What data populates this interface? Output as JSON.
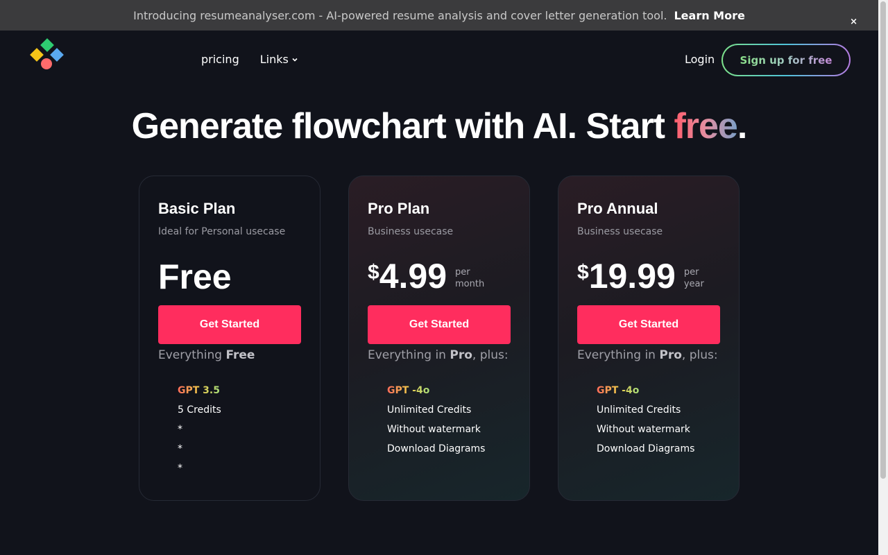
{
  "banner": {
    "text": "Introducing resumeanalyser.com - AI-powered resume analysis and cover letter generation tool.",
    "link_label": "Learn More",
    "close_label": "×"
  },
  "nav": {
    "pricing_label": "pricing",
    "links_label": "Links",
    "login_label": "Login",
    "signup_label": "Sign up for free"
  },
  "hero": {
    "title_main": "Generate flowchart with AI. Start ",
    "title_highlight": "free",
    "title_end": "."
  },
  "plans": [
    {
      "name": "Basic Plan",
      "description": "Ideal for Personal usecase",
      "price": "Free",
      "button_label": "Get Started",
      "everything_prefix": "Everything ",
      "everything_bold": "Free",
      "everything_suffix": "",
      "features": [
        "GPT 3.5",
        "5 Credits",
        "*",
        "*",
        "*"
      ]
    },
    {
      "name": "Pro Plan",
      "description": "Business usecase",
      "currency": "$",
      "amount": "4.99",
      "period_line1": "per",
      "period_line2": "month",
      "button_label": "Get Started",
      "everything_prefix": "Everything in ",
      "everything_bold": "Pro",
      "everything_suffix": ", plus:",
      "features": [
        "GPT -4o",
        "Unlimited Credits",
        "Without watermark",
        "Download Diagrams"
      ]
    },
    {
      "name": "Pro Annual",
      "description": "Business usecase",
      "currency": "$",
      "amount": "19.99",
      "period_line1": "per",
      "period_line2": "year",
      "button_label": "Get Started",
      "everything_prefix": "Everything in ",
      "everything_bold": "Pro",
      "everything_suffix": ", plus:",
      "features": [
        "GPT -4o",
        "Unlimited Credits",
        "Without watermark",
        "Download Diagrams"
      ]
    }
  ],
  "colors": {
    "background": "#11131b",
    "accent_button": "#ff2d5e",
    "banner": "#3b3b3d"
  }
}
